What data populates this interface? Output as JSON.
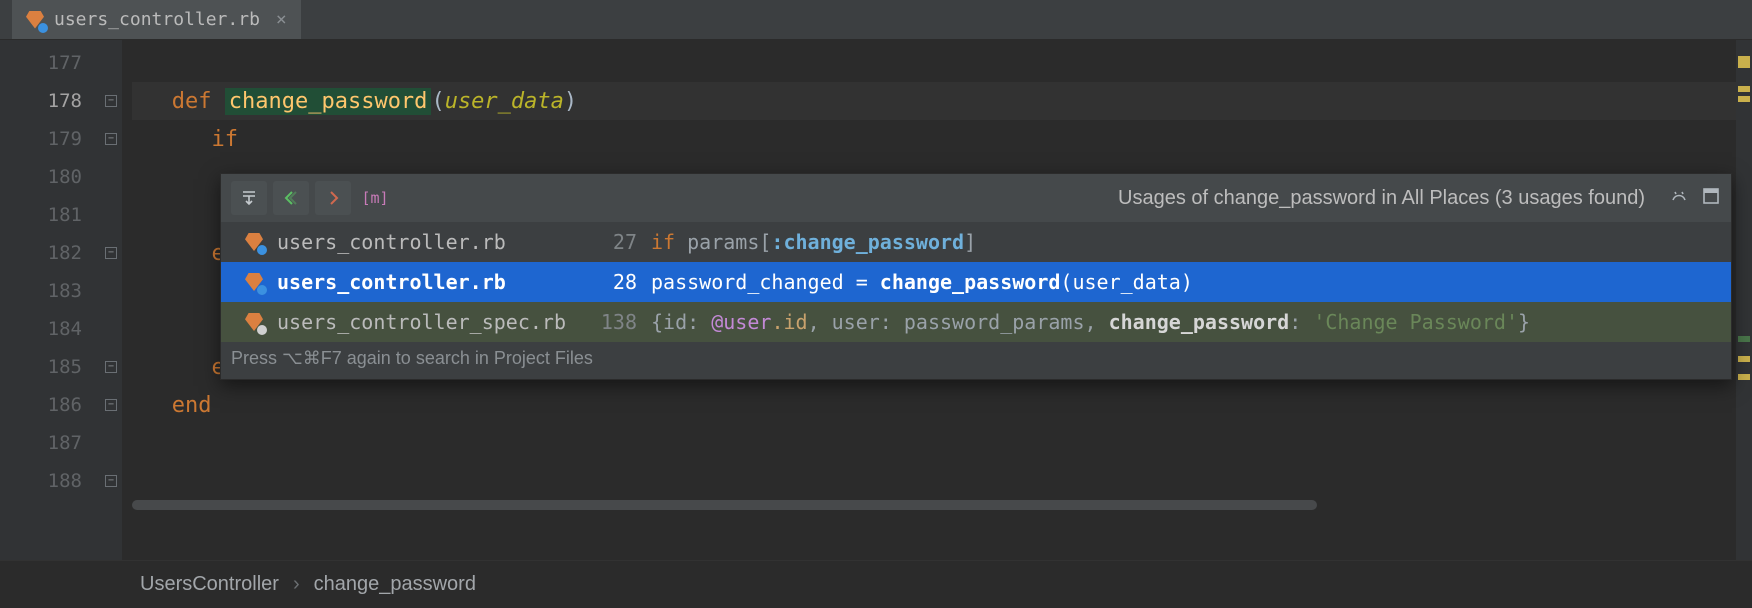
{
  "tab": {
    "filename": "users_controller.rb"
  },
  "gutter": {
    "start": 177,
    "end": 188,
    "active": 178
  },
  "code": {
    "def": "def",
    "fn": "change_password",
    "arg": "user_data",
    "if": "if",
    "el": "el",
    "false": "false",
    "end1": "end",
    "end2": "end"
  },
  "popup": {
    "title": "Usages of change_password in All Places (3 usages found)",
    "hint": "Press ⌥⌘F7 again to search in Project Files",
    "rows": [
      {
        "file": "users_controller.rb",
        "line": "27",
        "icon": "ruby",
        "selected": false,
        "snippet": {
          "prefix_kw": "if",
          "text1": " params[",
          "sym": ":change_password",
          "text2": "]"
        }
      },
      {
        "file": "users_controller.rb",
        "line": "28",
        "icon": "ruby",
        "selected": true,
        "snippet": {
          "text1": "password_changed = ",
          "bold": "change_password",
          "text2": "(user_data)"
        }
      },
      {
        "file": "users_controller_spec.rb",
        "line": "138",
        "icon": "ruby-spec",
        "selected": false,
        "snippet": {
          "text1": "{id: ",
          "ivar": "@user",
          "method": ".id",
          "text2": ", user: password_params, ",
          "bold": "change_password",
          "text3": ": ",
          "str": "'Change Password'",
          "text4": "}"
        }
      }
    ]
  },
  "breadcrumb": {
    "a": "UsersController",
    "b": "change_password"
  }
}
